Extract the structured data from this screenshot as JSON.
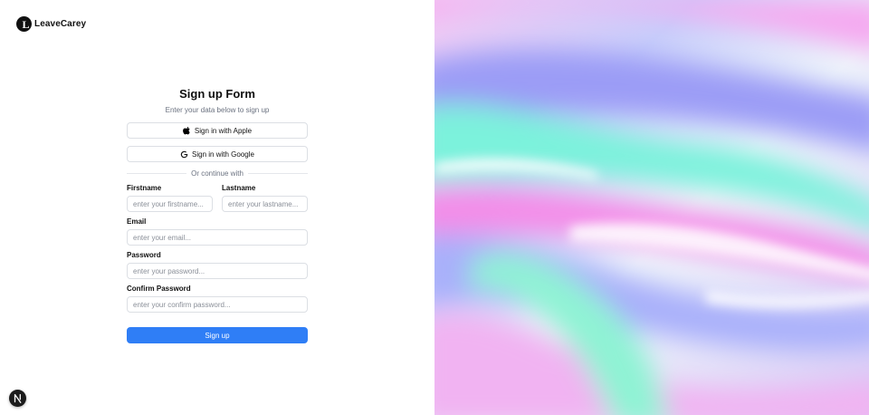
{
  "brand": {
    "name": "LeaveCarey",
    "mark_letter": "L"
  },
  "form": {
    "title": "Sign up Form",
    "subtitle": "Enter your data below to sign up",
    "apple_button": "Sign in with Apple",
    "google_button": "Sign in with Google",
    "divider": "Or continue with",
    "fields": {
      "firstname": {
        "label": "Firstname",
        "placeholder": "enter your firstname..."
      },
      "lastname": {
        "label": "Lastname",
        "placeholder": "enter your lastname..."
      },
      "email": {
        "label": "Email",
        "placeholder": "enter your email..."
      },
      "password": {
        "label": "Password",
        "placeholder": "enter your password..."
      },
      "confirm_password": {
        "label": "Confirm Password",
        "placeholder": "enter your confirm password..."
      }
    },
    "submit": "Sign up"
  },
  "dev_badge": {
    "letter": "N",
    "icon": "nextjs-icon"
  },
  "colors": {
    "accent": "#2f7ef6",
    "text": "#111827",
    "muted": "#6b7280",
    "border": "#dcdfe4"
  },
  "hero": {
    "image": "iridescent-holographic-gradient"
  }
}
